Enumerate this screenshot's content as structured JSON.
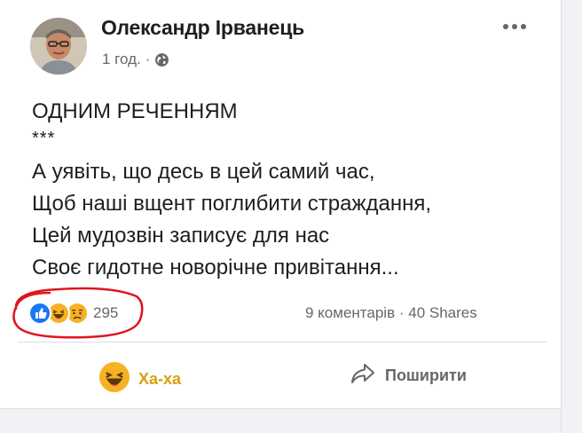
{
  "post": {
    "author": "Олександр Ірванець",
    "time": "1 год.",
    "separator": "·",
    "title": "ОДНИМ РЕЧЕННЯМ",
    "stars": "***",
    "lines": [
      "А уявіть, що десь в цей самий час,",
      "Щоб наші вщент поглибити страждання,",
      "Цей мудозвін записує для нас",
      "Своє гидотне новорічне привітання..."
    ]
  },
  "reactions": {
    "icons": [
      "like-icon",
      "haha-icon",
      "sad-icon"
    ],
    "count": "295"
  },
  "stats": {
    "comments": "9 коментарів",
    "dot": "·",
    "shares": "40 Shares"
  },
  "actions": {
    "haha_label": "Ха-ха",
    "share_label": "Поширити"
  },
  "colors": {
    "like": "#1877f2",
    "haha": "#f7b125",
    "haha_text": "#d8a00b",
    "highlight": "#e0141e",
    "muted": "#65676b"
  }
}
